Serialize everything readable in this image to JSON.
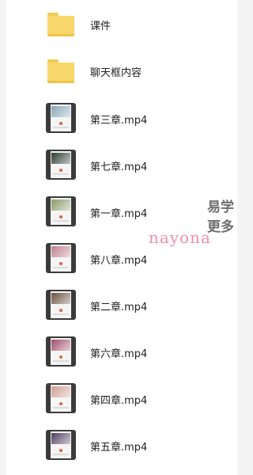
{
  "files": [
    {
      "name": "课件",
      "type": "folder"
    },
    {
      "name": "聊天框内容",
      "type": "folder"
    },
    {
      "name": "第三章.mp4",
      "type": "video",
      "preview_color": "#8aa6b8"
    },
    {
      "name": "第七章.mp4",
      "type": "video",
      "preview_color": "#2a3a30"
    },
    {
      "name": "第一章.mp4",
      "type": "video",
      "preview_color": "#8a9a6a"
    },
    {
      "name": "第八章.mp4",
      "type": "video",
      "preview_color": "#c08090"
    },
    {
      "name": "第二章.mp4",
      "type": "video",
      "preview_color": "#6a5040"
    },
    {
      "name": "第六章.mp4",
      "type": "video",
      "preview_color": "#a05070"
    },
    {
      "name": "第四章.mp4",
      "type": "video",
      "preview_color": "#d0a090"
    },
    {
      "name": "第五章.mp4",
      "type": "video",
      "preview_color": "#504060"
    }
  ],
  "watermark": {
    "text": "nayona",
    "side_text_line1": "易学",
    "side_text_line2": "更多"
  }
}
